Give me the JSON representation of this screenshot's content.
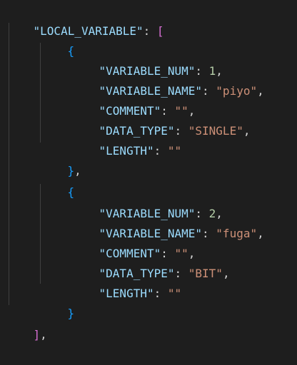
{
  "root": {
    "key": "\"LOCAL_VARIABLE\"",
    "open": "[",
    "close": "]"
  },
  "objects": [
    {
      "open": "{",
      "close": "}",
      "fields": [
        {
          "key": "\"VARIABLE_NUM\"",
          "value": "1"
        },
        {
          "key": "\"VARIABLE_NAME\"",
          "value": "\"piyo\""
        },
        {
          "key": "\"COMMENT\"",
          "value": "\"\""
        },
        {
          "key": "\"DATA_TYPE\"",
          "value": "\"SINGLE\""
        },
        {
          "key": "\"LENGTH\"",
          "value": "\"\""
        }
      ]
    },
    {
      "open": "{",
      "close": "}",
      "fields": [
        {
          "key": "\"VARIABLE_NUM\"",
          "value": "2"
        },
        {
          "key": "\"VARIABLE_NAME\"",
          "value": "\"fuga\""
        },
        {
          "key": "\"COMMENT\"",
          "value": "\"\""
        },
        {
          "key": "\"DATA_TYPE\"",
          "value": "\"BIT\""
        },
        {
          "key": "\"LENGTH\"",
          "value": "\"\""
        }
      ]
    }
  ],
  "colors": {
    "background": "#1e1e1e",
    "key": "#9cdcfe",
    "string": "#ce9178",
    "number": "#b5cea8",
    "bracket_level1": "#da70d6",
    "bracket_level2": "#179fff",
    "punctuation": "#d4d4d4"
  }
}
